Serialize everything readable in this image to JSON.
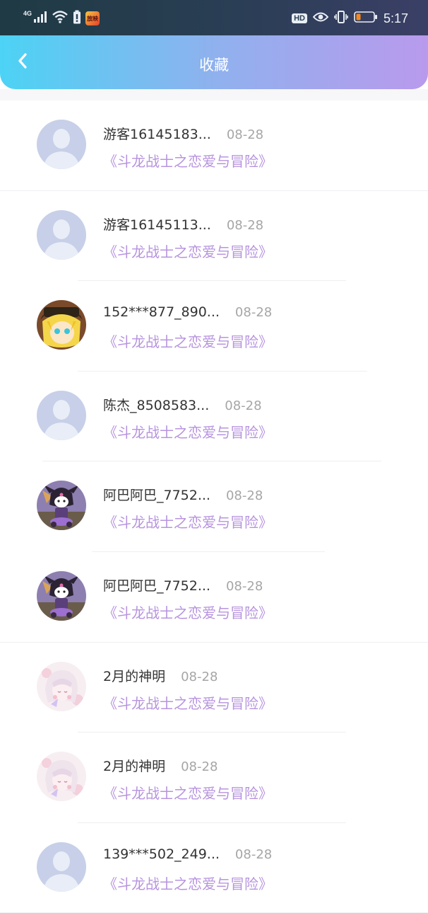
{
  "status_bar": {
    "network": "4G",
    "app_badge": "放映",
    "hd": "HD",
    "time": "5:17"
  },
  "header": {
    "title": "收藏"
  },
  "colors": {
    "header_gradient": [
      "#4cd3f5",
      "#b99aec"
    ],
    "accent_text": "#b794df"
  },
  "favorites": [
    {
      "name": "游客16145183...",
      "date": "08-28",
      "subtitle": "《斗龙战士之恋爱与冒险》",
      "avatar": "default-avatar-icon"
    },
    {
      "name": "游客16145113...",
      "date": "08-28",
      "subtitle": "《斗龙战士之恋爱与冒险》",
      "avatar": "default-avatar-icon"
    },
    {
      "name": "152***877_890...",
      "date": "08-28",
      "subtitle": "《斗龙战士之恋爱与冒险》",
      "avatar": "anime-blonde-avatar"
    },
    {
      "name": "陈杰_8508583...",
      "date": "08-28",
      "subtitle": "《斗龙战士之恋爱与冒险》",
      "avatar": "default-avatar-icon"
    },
    {
      "name": "阿巴阿巴_7752...",
      "date": "08-28",
      "subtitle": "《斗龙战士之恋爱与冒险》",
      "avatar": "kuromi-avatar"
    },
    {
      "name": "阿巴阿巴_7752...",
      "date": "08-28",
      "subtitle": "《斗龙战士之恋爱与冒险》",
      "avatar": "kuromi-avatar"
    },
    {
      "name": "2月的神明",
      "date": "08-28",
      "subtitle": "《斗龙战士之恋爱与冒险》",
      "avatar": "anime-pink-avatar"
    },
    {
      "name": "2月的神明",
      "date": "08-28",
      "subtitle": "《斗龙战士之恋爱与冒险》",
      "avatar": "anime-pink-avatar"
    },
    {
      "name": "139***502_249...",
      "date": "08-28",
      "subtitle": "《斗龙战士之恋爱与冒险》",
      "avatar": "default-avatar-icon"
    }
  ]
}
